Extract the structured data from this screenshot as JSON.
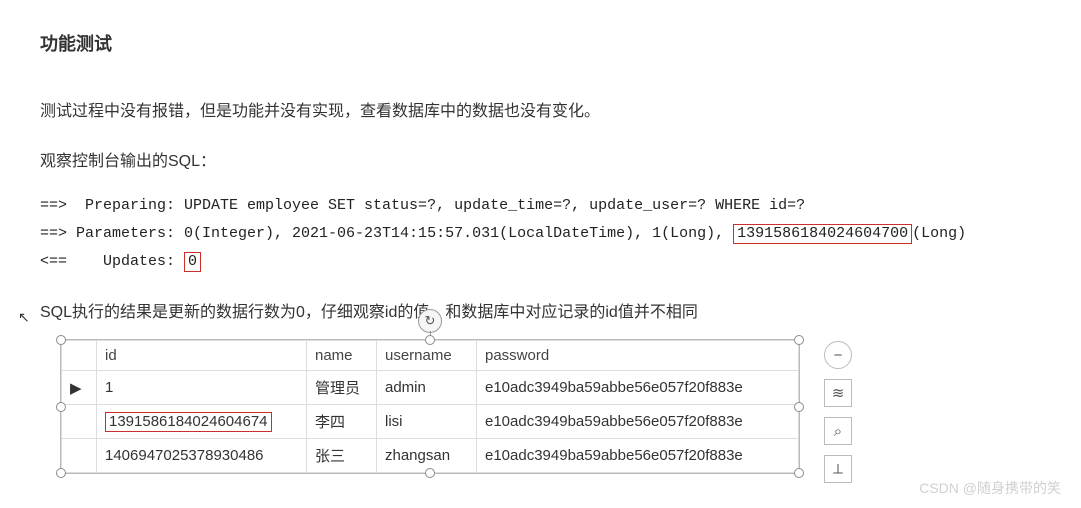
{
  "title": "功能测试",
  "para1": "测试过程中没有报错，但是功能并没有实现，查看数据库中的数据也没有变化。",
  "para2": "观察控制台输出的SQL：",
  "sql": {
    "line1_pre": "==>  Preparing: UPDATE employee SET status=?, update_time=?, update_user=? WHERE id=?",
    "line2_a": "==> Parameters: 0(Integer), 2021-06-23T14:15:57.031(LocalDateTime), 1(Long), ",
    "line2_box": "1391586184024604700",
    "line2_c": "(Long)",
    "line3_a": "<==    Updates: ",
    "line3_box": "0"
  },
  "summary": "SQL执行的结果是更新的数据行数为0，仔细观察id的值，和数据库中对应记录的id值并不相同",
  "table": {
    "headers": [
      "id",
      "name",
      "username",
      "password"
    ],
    "rows": [
      {
        "mark": "▶",
        "id": "1",
        "id_boxed": false,
        "name": "管理员",
        "username": "admin",
        "password": "e10adc3949ba59abbe56e057f20f883e"
      },
      {
        "mark": "",
        "id": "1391586184024604674",
        "id_boxed": true,
        "name": "李四",
        "username": "lisi",
        "password": "e10adc3949ba59abbe56e057f20f883e"
      },
      {
        "mark": "",
        "id": "1406947025378930486",
        "id_boxed": false,
        "name": "张三",
        "username": "zhangsan",
        "password": "e10adc3949ba59abbe56e057f20f883e"
      }
    ]
  },
  "tools": {
    "minus": "−",
    "layers": "≋",
    "zoom": "⌕",
    "crop": "⟂"
  },
  "rotate_glyph": "↻",
  "watermark": "CSDN @随身携带的笑"
}
